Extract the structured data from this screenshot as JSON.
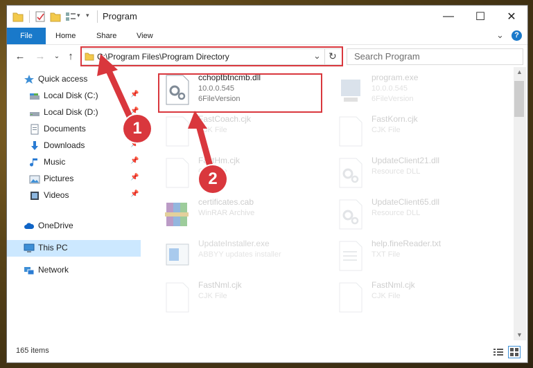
{
  "window": {
    "title": "Program",
    "minimize": "—",
    "maximize": "☐",
    "close": "✕"
  },
  "ribbon": {
    "tabs": [
      {
        "label": "File"
      },
      {
        "label": "Home"
      },
      {
        "label": "Share"
      },
      {
        "label": "View"
      }
    ],
    "help": "?",
    "expand": "⌄"
  },
  "address": {
    "path": "C:\\Program Files\\Program Directory",
    "dropdown": "⌄",
    "refresh": "↻"
  },
  "search": {
    "placeholder": "Search Program"
  },
  "nav": {
    "back": "←",
    "forward": "→",
    "recent": "⌄",
    "up": "↑"
  },
  "sidebar": {
    "items": [
      {
        "label": "Quick access",
        "icon": "star-icon",
        "pinned": false
      },
      {
        "label": "Local Disk (C:)",
        "icon": "drive-icon",
        "pinned": true
      },
      {
        "label": "Local Disk (D:)",
        "icon": "drive-icon",
        "pinned": true
      },
      {
        "label": "Documents",
        "icon": "documents-icon",
        "pinned": true
      },
      {
        "label": "Downloads",
        "icon": "download-icon",
        "pinned": true
      },
      {
        "label": "Music",
        "icon": "music-icon",
        "pinned": true
      },
      {
        "label": "Pictures",
        "icon": "pictures-icon",
        "pinned": true
      },
      {
        "label": "Videos",
        "icon": "videos-icon",
        "pinned": true
      },
      {
        "label": "OneDrive",
        "icon": "cloud-icon",
        "pinned": false
      },
      {
        "label": "This PC",
        "icon": "computer-icon",
        "pinned": false,
        "selected": true
      },
      {
        "label": "Network",
        "icon": "network-icon",
        "pinned": false
      }
    ]
  },
  "files": [
    {
      "name": "cchoptbtncmb.dll",
      "line1": "10.0.0.545",
      "line2": "6FileVersion",
      "icon": "gear-file-icon",
      "highlight": true
    },
    {
      "name": "program.exe",
      "line1": "10.0.0.545",
      "line2": "6FileVersion",
      "icon": "exe-icon"
    },
    {
      "name": "FastCoach.cjk",
      "line1": "CJK File",
      "icon": "blank-file-icon"
    },
    {
      "name": "FastKorn.cjk",
      "line1": "CJK File",
      "icon": "blank-file-icon"
    },
    {
      "name": "FastHm.cjk",
      "line1": "CJK File",
      "icon": "blank-file-icon"
    },
    {
      "name": "UpdateClient21.dll",
      "line1": "Resource DLL",
      "icon": "gear-file-icon"
    },
    {
      "name": "certificates.cab",
      "line1": "WinRAR Archive",
      "icon": "archive-icon"
    },
    {
      "name": "UpdateClient65.dll",
      "line1": "Resource DLL",
      "icon": "gear-file-icon"
    },
    {
      "name": "UpdateInstaller.exe",
      "line1": "ABBYY updates installer",
      "icon": "installer-icon"
    },
    {
      "name": "help.fineReader.txt",
      "line1": "TXT File",
      "icon": "text-file-icon"
    },
    {
      "name": "FastNml.cjk",
      "line1": "CJK File",
      "icon": "blank-file-icon"
    },
    {
      "name": "FastNml.cjk",
      "line1": "CJK File",
      "icon": "blank-file-icon"
    }
  ],
  "status": {
    "count": "165 items"
  },
  "callouts": [
    {
      "label": "1"
    },
    {
      "label": "2"
    }
  ],
  "colors": {
    "accent": "#1979ca",
    "highlight": "#d9373d",
    "selected": "#cce8ff"
  }
}
